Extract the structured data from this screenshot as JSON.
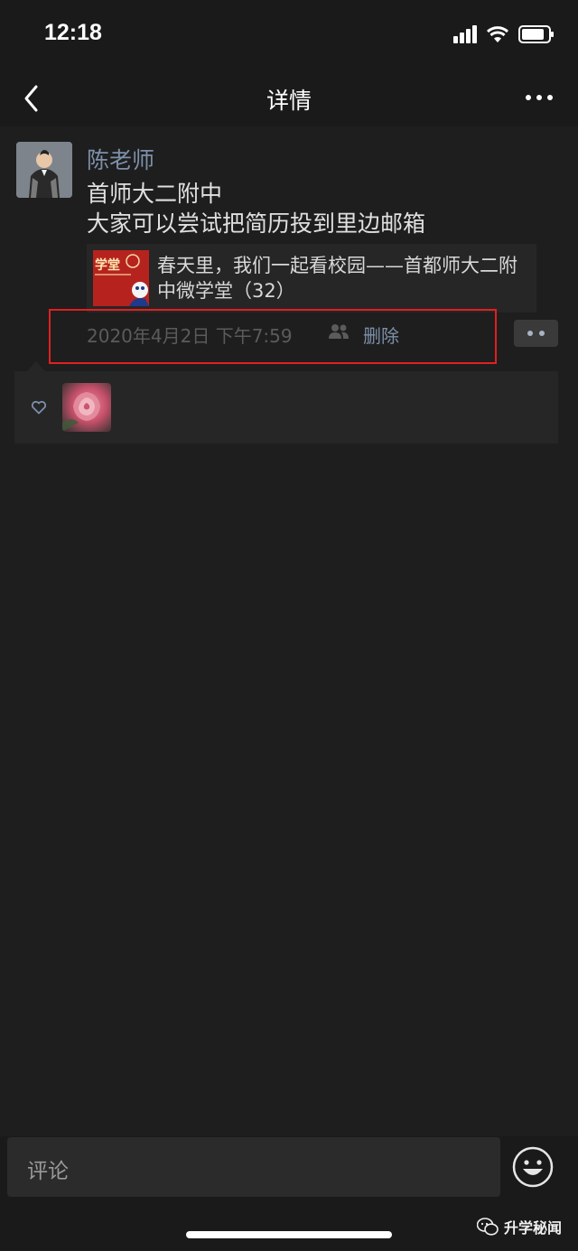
{
  "status_bar": {
    "time": "12:18"
  },
  "nav": {
    "title": "详情"
  },
  "post": {
    "author": "陈老师",
    "text_line1": "首师大二附中",
    "text_line2": "大家可以尝试把简历投到里边邮箱",
    "link_card": {
      "title": "春天里，我们一起看校园——首都师大二附中微学堂（32）",
      "thumb_text": "学堂"
    },
    "timestamp": "2020年4月2日 下午7:59",
    "delete_label": "删除"
  },
  "comment_bar": {
    "placeholder": "评论"
  },
  "watermark": {
    "text": "升学秘闻"
  },
  "colors": {
    "background": "#1e1e1e",
    "link_blue": "#7d90a9",
    "highlight_red": "#e02020"
  }
}
